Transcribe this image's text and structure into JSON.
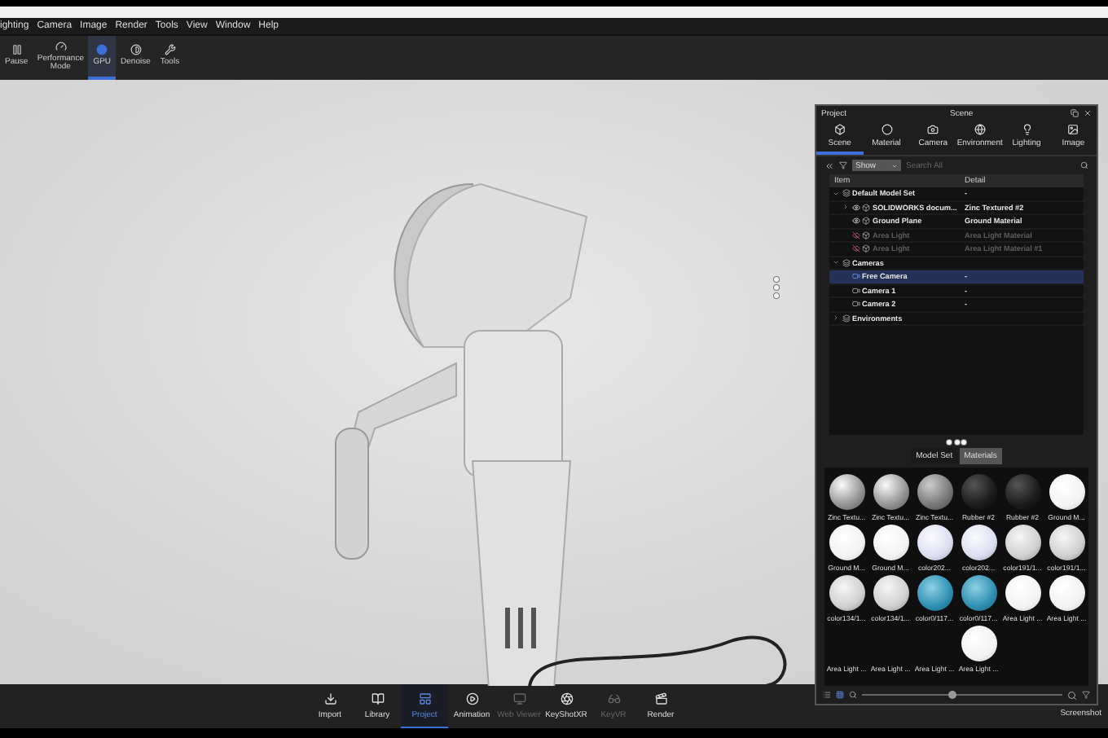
{
  "menu": [
    {
      "label": "ighting"
    },
    {
      "label": "Camera"
    },
    {
      "label": "Image"
    },
    {
      "label": "Render"
    },
    {
      "label": "Tools"
    },
    {
      "label": "View"
    },
    {
      "label": "Window"
    },
    {
      "label": "Help"
    }
  ],
  "toolbar": [
    {
      "label": "Pause",
      "selected": false
    },
    {
      "label": "Performance Mode",
      "selected": false
    },
    {
      "label": "GPU",
      "selected": true
    },
    {
      "label": "Denoise",
      "selected": false
    },
    {
      "label": "Tools",
      "selected": false
    }
  ],
  "panel": {
    "title": "Project",
    "subtitle": "Scene",
    "tabs": [
      {
        "label": "Scene",
        "selected": true
      },
      {
        "label": "Material",
        "selected": false
      },
      {
        "label": "Camera",
        "selected": false
      },
      {
        "label": "Environment",
        "selected": false
      },
      {
        "label": "Lighting",
        "selected": false
      },
      {
        "label": "Image",
        "selected": false
      }
    ],
    "filter": {
      "value": "Show",
      "placeholder": "Search All"
    },
    "columns": [
      "Item",
      "Detail"
    ],
    "tree": [
      {
        "label": "Default Model Set",
        "detail": "-",
        "expanded": true,
        "visible": true,
        "children": [
          {
            "label": "SOLIDWORKS docum...",
            "detail": "Zinc Textured #2",
            "expanded": false,
            "visible": true
          },
          {
            "label": "Ground Plane",
            "detail": "Ground Material",
            "visible": true
          },
          {
            "label": "Area Light",
            "detail": "Area Light Material",
            "visible": false
          },
          {
            "label": "Area Light",
            "detail": "Area Light Material #1",
            "visible": false
          }
        ]
      },
      {
        "label": "Cameras",
        "expanded": true,
        "visible": true,
        "children": [
          {
            "label": "Free Camera",
            "detail": "-",
            "visible": true,
            "selected": true
          },
          {
            "label": "Camera 1",
            "detail": "-",
            "visible": true,
            "selected": false
          },
          {
            "label": "Camera 2",
            "detail": "-",
            "visible": true,
            "selected": false
          }
        ]
      },
      {
        "label": "Environments",
        "expanded": false,
        "visible": true
      }
    ],
    "bottom_tabs": [
      {
        "label": "Model Set",
        "selected": false
      },
      {
        "label": "Materials",
        "selected": true
      }
    ],
    "materials": [
      {
        "label": "Zinc Textu...",
        "kind": "chrome"
      },
      {
        "label": "Zinc Textu...",
        "kind": "chrome"
      },
      {
        "label": "Zinc Textu...",
        "kind": "gray"
      },
      {
        "label": "Rubber #2",
        "kind": "dark"
      },
      {
        "label": "Rubber #2",
        "kind": "dark"
      },
      {
        "label": "Ground M...",
        "kind": "white"
      },
      {
        "label": "Ground M...",
        "kind": "white"
      },
      {
        "label": "Ground M...",
        "kind": "white"
      },
      {
        "label": "color202...",
        "kind": "lavender"
      },
      {
        "label": "color202...",
        "kind": "lavender"
      },
      {
        "label": "color191/1...",
        "kind": "light"
      },
      {
        "label": "color191/1...",
        "kind": "light"
      },
      {
        "label": "color134/1...",
        "kind": "light"
      },
      {
        "label": "color134/1...",
        "kind": "light"
      },
      {
        "label": "color0/117...",
        "kind": "teal"
      },
      {
        "label": "color0/117...",
        "kind": "teal"
      },
      {
        "label": "Area Light ...",
        "kind": "white"
      },
      {
        "label": "Area Light ...",
        "kind": "white"
      },
      {
        "label": "Area Light ...",
        "kind": "blank"
      },
      {
        "label": "Area Light ...",
        "kind": "blank"
      },
      {
        "label": "Area Light ...",
        "kind": "blank"
      },
      {
        "label": "Area Light ...",
        "kind": "white"
      }
    ],
    "zoom": {
      "level": 0.45
    }
  },
  "dock": [
    {
      "label": "Import",
      "selected": false,
      "disabled": false
    },
    {
      "label": "Library",
      "selected": false,
      "disabled": false
    },
    {
      "label": "Project",
      "selected": true,
      "disabled": false
    },
    {
      "label": "Animation",
      "selected": false,
      "disabled": false
    },
    {
      "label": "Web Viewer",
      "selected": false,
      "disabled": true
    },
    {
      "label": "KeyShotXR",
      "selected": false,
      "disabled": false
    },
    {
      "label": "KeyVR",
      "selected": false,
      "disabled": true
    },
    {
      "label": "Render",
      "selected": false,
      "disabled": false
    }
  ],
  "screenshot": "Screenshot"
}
